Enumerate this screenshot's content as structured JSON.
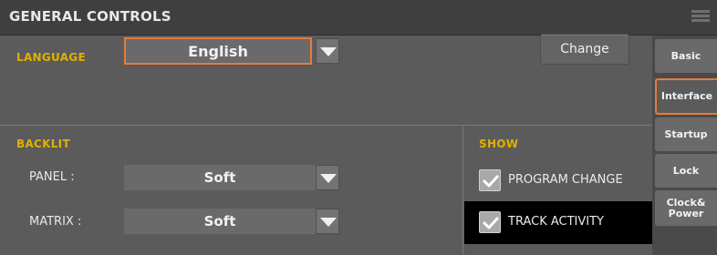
{
  "header": {
    "title": "GENERAL CONTROLS"
  },
  "language": {
    "section_label": "LANGUAGE",
    "selected_value": "English",
    "change_label": "Change"
  },
  "backlit": {
    "section_label": "BACKLIT",
    "panel_label": "PANEL :",
    "panel_value": "Soft",
    "matrix_label": "MATRIX :",
    "matrix_value": "Soft"
  },
  "show": {
    "section_label": "SHOW",
    "items": [
      {
        "label": "PROGRAM CHANGE",
        "checked": true
      },
      {
        "label": "TRACK ACTIVITY",
        "checked": true
      }
    ]
  },
  "tabs": [
    {
      "label": "Basic",
      "selected": false
    },
    {
      "label": "Interface",
      "selected": true
    },
    {
      "label": "Startup",
      "selected": false
    },
    {
      "label": "Lock",
      "selected": false
    },
    {
      "label_line1": "Clock&",
      "label_line2": "Power",
      "selected": false
    }
  ],
  "colors": {
    "accent": "#e67a3a",
    "section_label": "#e0b000",
    "active_row": "#000000"
  }
}
